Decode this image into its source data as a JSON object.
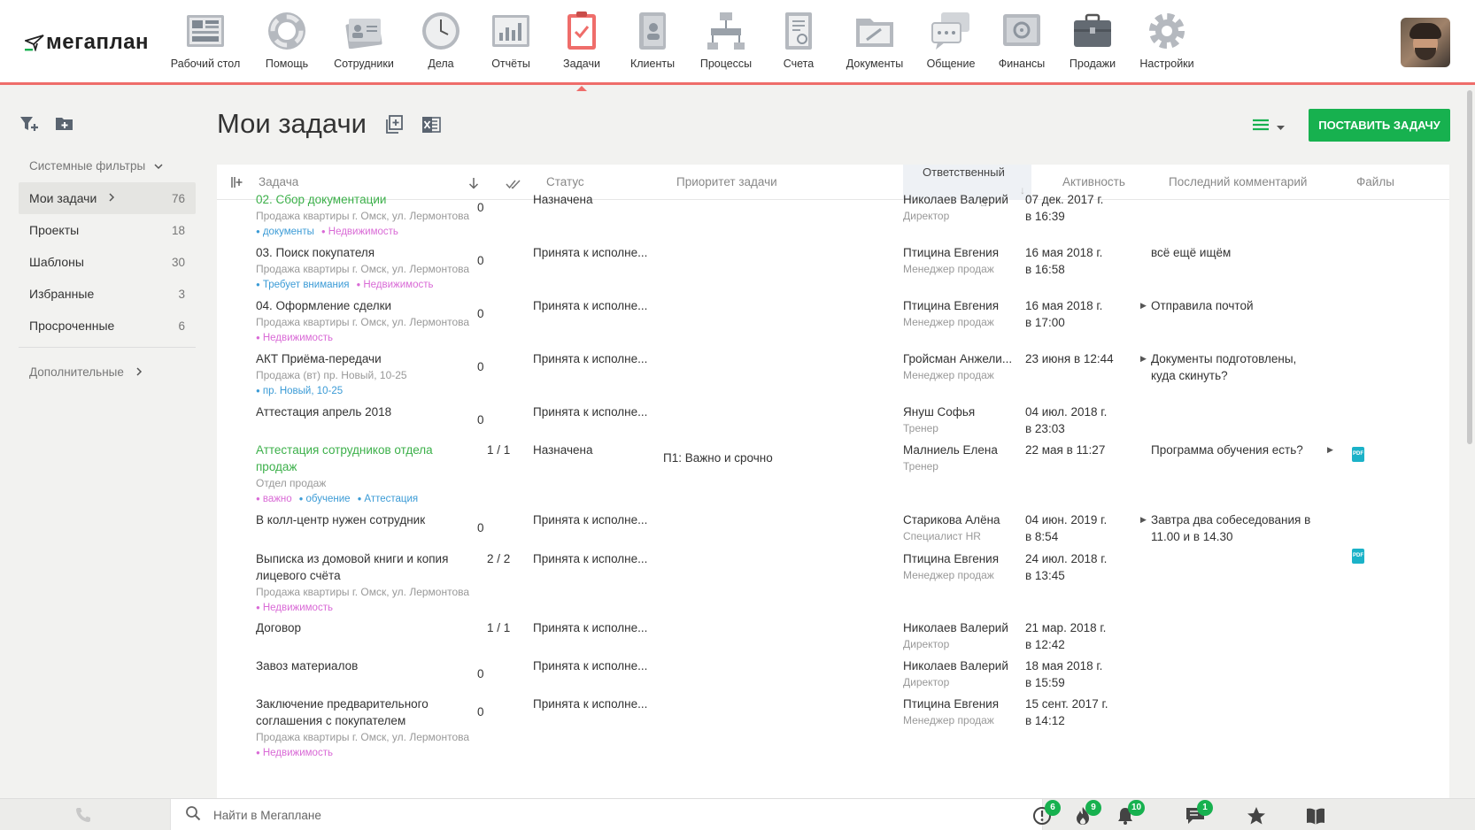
{
  "app": {
    "logo_text": "мегаплан",
    "nav": [
      {
        "label": "Рабочий стол",
        "icon": "desktop-icon"
      },
      {
        "label": "Помощь",
        "icon": "lifebuoy-icon"
      },
      {
        "label": "Сотрудники",
        "icon": "employees-icon"
      },
      {
        "label": "Дела",
        "icon": "clock-icon"
      },
      {
        "label": "Отчёты",
        "icon": "chart-icon"
      },
      {
        "label": "Задачи",
        "icon": "tasks-icon"
      },
      {
        "label": "Клиенты",
        "icon": "contacts-book-icon"
      },
      {
        "label": "Процессы",
        "icon": "process-icon"
      },
      {
        "label": "Счета",
        "icon": "invoice-icon"
      },
      {
        "label": "Документы",
        "icon": "folder-icon"
      },
      {
        "label": "Общение",
        "icon": "chat-icon"
      },
      {
        "label": "Финансы",
        "icon": "safe-icon"
      },
      {
        "label": "Продажи",
        "icon": "briefcase-icon"
      },
      {
        "label": "Настройки",
        "icon": "gear-icon"
      }
    ],
    "active_nav": "Задачи",
    "accent_color": "#ef6d6a",
    "brand_green": "#17b14f"
  },
  "sidebar": {
    "filters_heading": "Системные фильтры",
    "items": [
      {
        "label": "Мои задачи",
        "count": "76"
      },
      {
        "label": "Проекты",
        "count": "18"
      },
      {
        "label": "Шаблоны",
        "count": "30"
      },
      {
        "label": "Избранные",
        "count": "3"
      },
      {
        "label": "Просроченные",
        "count": "6"
      }
    ],
    "extra_label": "Дополнительные"
  },
  "page": {
    "title": "Мои задачи",
    "add_button": "ПОСТАВИТЬ ЗАДАЧУ"
  },
  "table": {
    "headers": {
      "task": "Задача",
      "status": "Статус",
      "priority": "Приоритет задачи",
      "responsible": "Ответственный",
      "activity": "Активность",
      "last_comment": "Последний комментарий",
      "files": "Файлы"
    },
    "rows": [
      {
        "name": "02. Сбор документации",
        "green": true,
        "sub": "Продажа квартиры г. Омск, ул. Лермонтова",
        "tags": [
          {
            "t": "документы",
            "c": "blue"
          },
          {
            "t": "Недвижимость",
            "c": "pink"
          }
        ],
        "count": "0",
        "status": "Назначена",
        "priority": "",
        "resp": "Николаев Валерий",
        "role": "Директор",
        "act1": "07 дек. 2017 г.",
        "act2": "в 16:39",
        "comment": "",
        "comment_arrow": false,
        "pdf": false
      },
      {
        "name": "03. Поиск покупателя",
        "green": false,
        "sub": "Продажа квартиры г. Омск, ул. Лермонтова",
        "tags": [
          {
            "t": "Требует внимания",
            "c": "blue"
          },
          {
            "t": "Недвижимость",
            "c": "pink"
          }
        ],
        "count": "0",
        "status": "Принята к исполне...",
        "priority": "",
        "resp": "Птицина Евгения",
        "role": "Менеджер продаж",
        "act1": "16 мая 2018 г.",
        "act2": "в 16:58",
        "comment": "всё ещё ищём",
        "comment_arrow": false,
        "pdf": false
      },
      {
        "name": "04. Оформление сделки",
        "green": false,
        "sub": "Продажа квартиры г. Омск, ул. Лермонтова",
        "tags": [
          {
            "t": "Недвижимость",
            "c": "pink"
          }
        ],
        "count": "0",
        "status": "Принята к исполне...",
        "priority": "",
        "resp": "Птицина Евгения",
        "role": "Менеджер продаж",
        "act1": "16 мая 2018 г.",
        "act2": "в 17:00",
        "comment": "Отправила почтой",
        "comment_arrow": true,
        "pdf": false
      },
      {
        "name": "АКТ Приёма-передачи",
        "green": false,
        "sub": "Продажа (вт) пр. Новый, 10-25",
        "tags": [
          {
            "t": "пр. Новый, 10-25",
            "c": "blue"
          }
        ],
        "count": "0",
        "status": "Принята к исполне...",
        "priority": "",
        "resp": "Гройсман Анжели...",
        "role": "Менеджер продаж",
        "act1": "23 июня в 12:44",
        "act2": "",
        "comment": "Документы подготовлены, куда скинуть?",
        "comment_arrow": true,
        "pdf": false
      },
      {
        "name": "Аттестация апрель 2018",
        "green": false,
        "sub": "",
        "tags": [],
        "count": "0",
        "status": "Принята к исполне...",
        "priority": "",
        "resp": "Януш Софья",
        "role": "Тренер",
        "act1": "04 июл. 2018 г.",
        "act2": "в 23:03",
        "comment": "",
        "comment_arrow": false,
        "pdf": false
      },
      {
        "name": "Аттестация сотрудников отдела продаж",
        "green": true,
        "sub": "Отдел продаж",
        "tags": [
          {
            "t": "важно",
            "c": "pink"
          },
          {
            "t": "обучение",
            "c": "blue"
          },
          {
            "t": "Аттестация",
            "c": "blue"
          }
        ],
        "count": "1 / 1",
        "status": "Назначена",
        "priority": "П1: Важно и срочно",
        "resp": "Малниель Елена",
        "role": "Тренер",
        "act1": "22 мая в 11:27",
        "act2": "",
        "comment": "Программа обучения есть?",
        "comment_arrow": false,
        "pdf": true
      },
      {
        "name": "В колл-центр нужен сотрудник",
        "green": false,
        "sub": "",
        "tags": [],
        "count": "0",
        "status": "Принята к исполне...",
        "priority": "",
        "resp": "Старикова Алёна",
        "role": "Специалист HR",
        "act1": "04 июн. 2019 г.",
        "act2": "в 8:54",
        "comment": "Завтра два собеседования в 11.00 и в 14.30",
        "comment_arrow": true,
        "pdf": false
      },
      {
        "name": "Выписка из домовой книги и копия лицевого счёта",
        "green": false,
        "sub": "Продажа квартиры г. Омск, ул. Лермонтова",
        "tags": [
          {
            "t": "Недвижимость",
            "c": "pink"
          }
        ],
        "count": "2 / 2",
        "status": "Принята к исполне...",
        "priority": "",
        "resp": "Птицина Евгения",
        "role": "Менеджер продаж",
        "act1": "24 июл. 2018 г.",
        "act2": "в 13:45",
        "comment": "",
        "comment_arrow": false,
        "pdf": true
      },
      {
        "name": "Договор",
        "green": false,
        "sub": "",
        "tags": [],
        "count": "1 / 1",
        "status": "Принята к исполне...",
        "priority": "",
        "resp": "Николаев Валерий",
        "role": "Директор",
        "act1": "21 мар. 2018 г.",
        "act2": "в 12:42",
        "comment": "",
        "comment_arrow": false,
        "pdf": false
      },
      {
        "name": "Завоз материалов",
        "green": false,
        "sub": "",
        "tags": [],
        "count": "0",
        "status": "Принята к исполне...",
        "priority": "",
        "resp": "Николаев Валерий",
        "role": "Директор",
        "act1": "18 мая 2018 г.",
        "act2": "в 15:59",
        "comment": "",
        "comment_arrow": false,
        "pdf": false
      },
      {
        "name": "Заключение предварительного соглашения с покупателем",
        "green": false,
        "sub": "Продажа квартиры г. Омск, ул. Лермонтова",
        "tags": [
          {
            "t": "Недвижимость",
            "c": "pink"
          }
        ],
        "count": "0",
        "status": "Принята к исполне...",
        "priority": "",
        "resp": "Птицина Евгения",
        "role": "Менеджер продаж",
        "act1": "15 сент. 2017 г.",
        "act2": "в 14:12",
        "comment": "",
        "comment_arrow": false,
        "pdf": false
      }
    ]
  },
  "bottombar": {
    "search_placeholder": "Найти в Мегаплане",
    "badges": [
      {
        "icon": "alert-icon",
        "count": "6"
      },
      {
        "icon": "fire-icon",
        "count": "9"
      },
      {
        "icon": "bell-icon",
        "count": "10"
      },
      {
        "icon": "messages-icon",
        "count": "1"
      },
      {
        "icon": "star-icon",
        "count": ""
      },
      {
        "icon": "book-icon",
        "count": ""
      }
    ]
  }
}
